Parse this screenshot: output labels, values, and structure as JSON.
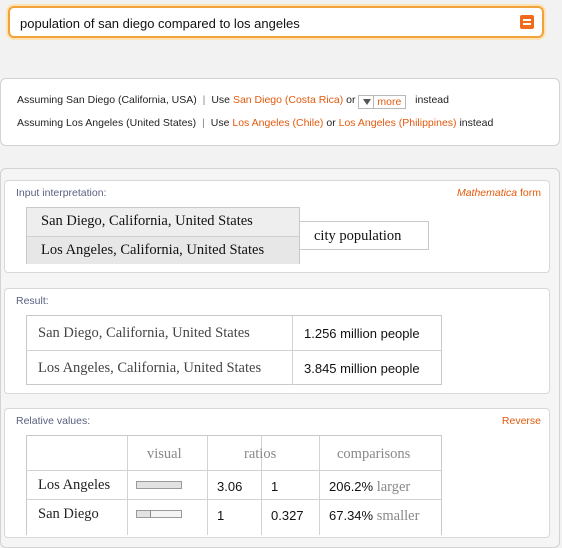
{
  "search": {
    "query": "population of san diego compared to los angeles"
  },
  "assumptions": [
    {
      "prefix": "Assuming San Diego (California, USA)",
      "use": "Use",
      "options": [
        "San Diego (Costa Rica)"
      ],
      "connector": "or",
      "more_label": "more",
      "suffix": "instead"
    },
    {
      "prefix": "Assuming Los Angeles (United States)",
      "use": "Use",
      "options": [
        "Los Angeles (Chile)",
        "Los Angeles (Philippines)"
      ],
      "connector": "or",
      "suffix": "instead"
    }
  ],
  "pods": {
    "input": {
      "title": "Input interpretation:",
      "action_italic": "Mathematica",
      "action_rest": "form",
      "rows": [
        "San Diego, California, United States",
        "Los Angeles, California, United States"
      ],
      "property": "city population"
    },
    "result": {
      "title": "Result:",
      "rows": [
        {
          "place": "San Diego, California, United States",
          "value": "1.256 million people"
        },
        {
          "place": "Los Angeles, California, United States",
          "value": "3.845 million people"
        }
      ]
    },
    "relative": {
      "title": "Relative values:",
      "action": "Reverse",
      "headers": {
        "visual": "visual",
        "ratios": "ratios",
        "comparisons": "comparisons"
      },
      "rows": [
        {
          "place": "Los Angeles",
          "visual_fraction": 1.0,
          "ratio_a": "3.06",
          "ratio_b": "1",
          "cmp_value": "206.2%",
          "cmp_word": "larger"
        },
        {
          "place": "San Diego",
          "visual_fraction": 0.327,
          "ratio_a": "1",
          "ratio_b": "0.327",
          "cmp_value": "67.34%",
          "cmp_word": "smaller"
        }
      ]
    }
  },
  "colors": {
    "accent": "#e35a0d",
    "search_border": "#f2a23a"
  }
}
